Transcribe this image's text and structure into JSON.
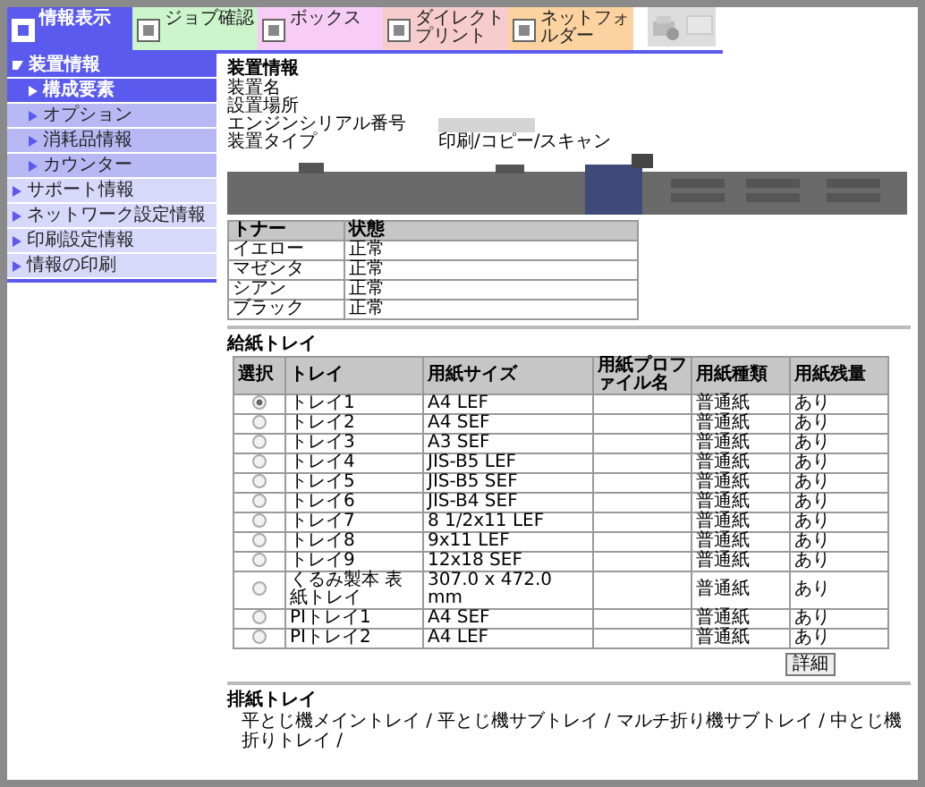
{
  "tabs": [
    {
      "label": "情報表示",
      "selected": true,
      "color": "#5a5aee"
    },
    {
      "label": "ジョブ確認",
      "selected": false,
      "color": "#ccf5cc"
    },
    {
      "label": "ボックス",
      "selected": false,
      "color": "#f7ccf7"
    },
    {
      "label": "ダイレクトプリント",
      "selected": false,
      "color": "#f7cccc"
    },
    {
      "label": "ネットフォルダー",
      "selected": false,
      "color": "#fcd3a0"
    }
  ],
  "sidebar": {
    "items": [
      {
        "label": "装置情報",
        "expanded": true,
        "selected": false,
        "children": [
          {
            "label": "構成要素",
            "selected": true
          },
          {
            "label": "オプション",
            "selected": false
          },
          {
            "label": "消耗品情報",
            "selected": false
          },
          {
            "label": "カウンター",
            "selected": false
          }
        ]
      },
      {
        "label": "サポート情報",
        "expanded": false,
        "selected": false
      },
      {
        "label": "ネットワーク設定情報",
        "expanded": false,
        "selected": false
      },
      {
        "label": "印刷設定情報",
        "expanded": false,
        "selected": false
      },
      {
        "label": "情報の印刷",
        "expanded": false,
        "selected": false
      }
    ]
  },
  "device_info": {
    "heading": "装置情報",
    "fields": [
      {
        "label": "装置名",
        "redacted": false
      },
      {
        "label": "設置場所",
        "redacted": false
      },
      {
        "label": "エンジンシリアル番号",
        "redacted": true
      },
      {
        "label": "装置タイプ",
        "value": "印刷/コピー/スキャン",
        "redacted": false
      }
    ]
  },
  "toner": {
    "columns": [
      "トナー",
      "状態"
    ],
    "rows": [
      [
        "イエロー",
        "正常"
      ],
      [
        "マゼンタ",
        "正常"
      ],
      [
        "シアン",
        "正常"
      ],
      [
        "ブラック",
        "正常"
      ]
    ]
  },
  "paper_trays": {
    "title": "給紙トレイ",
    "columns": [
      "選択",
      "トレイ",
      "用紙サイズ",
      "用紙プロファイル名",
      "用紙種類",
      "用紙残量"
    ],
    "rows": [
      {
        "selected": true,
        "tray": "トレイ1",
        "size": "A4 LEF",
        "type": "普通紙",
        "remaining": "あり"
      },
      {
        "selected": false,
        "tray": "トレイ2",
        "size": "A4 SEF",
        "type": "普通紙",
        "remaining": "あり"
      },
      {
        "selected": false,
        "tray": "トレイ3",
        "size": "A3 SEF",
        "type": "普通紙",
        "remaining": "あり"
      },
      {
        "selected": false,
        "tray": "トレイ4",
        "size": "JIS-B5 LEF",
        "type": "普通紙",
        "remaining": "あり"
      },
      {
        "selected": false,
        "tray": "トレイ5",
        "size": "JIS-B5 SEF",
        "type": "普通紙",
        "remaining": "あり"
      },
      {
        "selected": false,
        "tray": "トレイ6",
        "size": "JIS-B4 SEF",
        "type": "普通紙",
        "remaining": "あり"
      },
      {
        "selected": false,
        "tray": "トレイ7",
        "size": "8 1/2x11 LEF",
        "type": "普通紙",
        "remaining": "あり"
      },
      {
        "selected": false,
        "tray": "トレイ8",
        "size": "9x11 LEF",
        "type": "普通紙",
        "remaining": "あり"
      },
      {
        "selected": false,
        "tray": "トレイ9",
        "size": "12x18 SEF",
        "type": "普通紙",
        "remaining": "あり"
      },
      {
        "selected": false,
        "tray": "くるみ製本 表紙トレイ",
        "size": "307.0 x 472.0 mm",
        "type": "普通紙",
        "remaining": "あり"
      },
      {
        "selected": false,
        "tray": "PIトレイ1",
        "size": "A4 SEF",
        "type": "普通紙",
        "remaining": "あり"
      },
      {
        "selected": false,
        "tray": "PIトレイ2",
        "size": "A4 LEF",
        "type": "普通紙",
        "remaining": "あり"
      }
    ],
    "button": "詳細"
  },
  "output_trays": {
    "title": "排紙トレイ",
    "text": "平とじ機メイントレイ / 平とじ機サブトレイ / マルチ折り機サブトレイ / 中とじ機折りトレイ /"
  }
}
